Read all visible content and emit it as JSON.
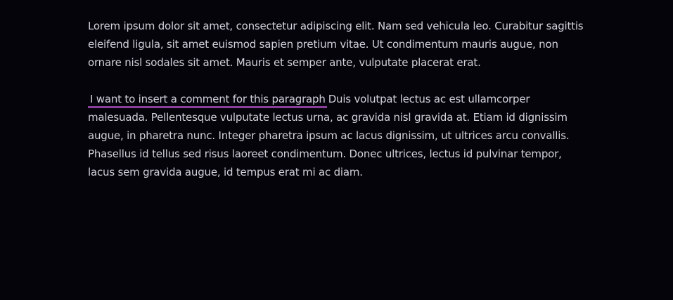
{
  "paragraphs": {
    "first": {
      "text": "Lorem ipsum dolor sit amet, consectetur adipiscing elit. Nam sed vehicula leo. Curabitur sagittis eleifend ligula, sit amet euismod sapien pretium vitae. Ut condimentum mauris augue, non ornare nisl sodales sit amet. Mauris et semper ante, vulputate placerat erat."
    },
    "second": {
      "comment": "I want to insert a comment for this paragraph",
      "text": "Duis volutpat lectus ac est ullamcorper malesuada. Pellentesque vulputate lectus urna, ac gravida nisl gravida at. Etiam id dignissim augue, in pharetra nunc. Integer pharetra ipsum ac lacus dignissim, ut ultrices arcu convallis. Phasellus id tellus sed risus laoreet condimentum. Donec ultrices, lectus id pulvinar tempor, lacus sem gravida augue, id tempus erat mi ac diam."
    }
  },
  "colors": {
    "background": "#05040b",
    "text": "#d2d0d8",
    "comment_underline": "#8a3f9a"
  }
}
